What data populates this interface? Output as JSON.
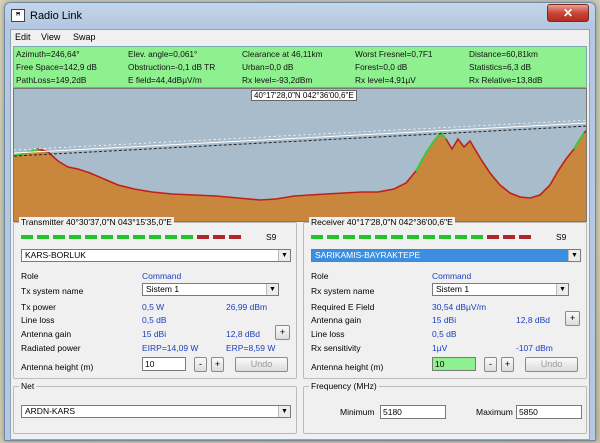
{
  "window": {
    "title": "Radio Link",
    "app_icon": "radio-mobile-icon",
    "close": "✕"
  },
  "menu": [
    "Edit",
    "View",
    "Swap"
  ],
  "info": {
    "row1": [
      "Azimuth=246,64°",
      "Elev. angle=0,061°",
      "Clearance at 46,11km",
      "Worst Fresnel=0,7F1",
      "Distance=60,81km"
    ],
    "row2": [
      "Free Space=142,9 dB",
      "Obstruction=-0,1 dB TR",
      "Urban=0,0 dB",
      "Forest=0,0 dB",
      "Statistics=6,3 dB"
    ],
    "row3": [
      "PathLoss=149,2dB",
      "E field=44,4dBµV/m",
      "Rx level=-93,2dBm",
      "Rx level=4,91µV",
      "Rx Relative=13,8dB"
    ]
  },
  "plot": {
    "cursor_coord": "40°17'28,0\"N 042°36'00,6\"E",
    "colors": {
      "sky": "#a9bccb",
      "terrain": "#c9873e",
      "los": "#c0201a"
    }
  },
  "transmitter": {
    "header": "Transmitter 40°30'37,0\"N 043°15'35,0\"E",
    "s_level": "S9",
    "station": "KARS-BORLUK",
    "role_label": "Role",
    "role": "Command",
    "tx_system_label": "Tx system name",
    "tx_system": "Sistem  1",
    "tx_power_label": "Tx power",
    "tx_power_w": "0,5 W",
    "tx_power_dbm": "26,99 dBm",
    "line_loss_label": "Line loss",
    "line_loss": "0,5 dB",
    "antenna_gain_label": "Antenna gain",
    "antenna_gain_dbi": "15 dBi",
    "antenna_gain_dbd": "12,8 dBd",
    "radiated_label": "Radiated power",
    "eirp": "EIRP=14,09 W",
    "erp": "ERP=8,59 W",
    "height_label": "Antenna height (m)",
    "height": "10",
    "undo": "Undo"
  },
  "receiver": {
    "header": "Receiver 40°17'28,0\"N 042°36'00,6\"E",
    "s_level": "S9",
    "station": "SARIKAMIS-BAYRAKTEPE",
    "role_label": "Role",
    "role": "Command",
    "rx_system_label": "Rx system name",
    "rx_system": "Sistem  1",
    "req_field_label": "Required E Field",
    "req_field": "30,54 dBµV/m",
    "antenna_gain_label": "Antenna gain",
    "antenna_gain_dbi": "15 dBi",
    "antenna_gain_dbd": "12,8 dBd",
    "line_loss_label": "Line loss",
    "line_loss": "0,5 dB",
    "sensitivity_label": "Rx sensitivity",
    "sensitivity_uv": "1µV",
    "sensitivity_dbm": "-107 dBm",
    "height_label": "Antenna height (m)",
    "height": "10",
    "undo": "Undo"
  },
  "net": {
    "header": "Net",
    "name": "ARDN-KARS"
  },
  "frequency": {
    "header": "Frequency (MHz)",
    "min_label": "Minimum",
    "min": "5180",
    "max_label": "Maximum",
    "max": "5850"
  },
  "buttons": {
    "plus": "+",
    "minus": "-"
  }
}
